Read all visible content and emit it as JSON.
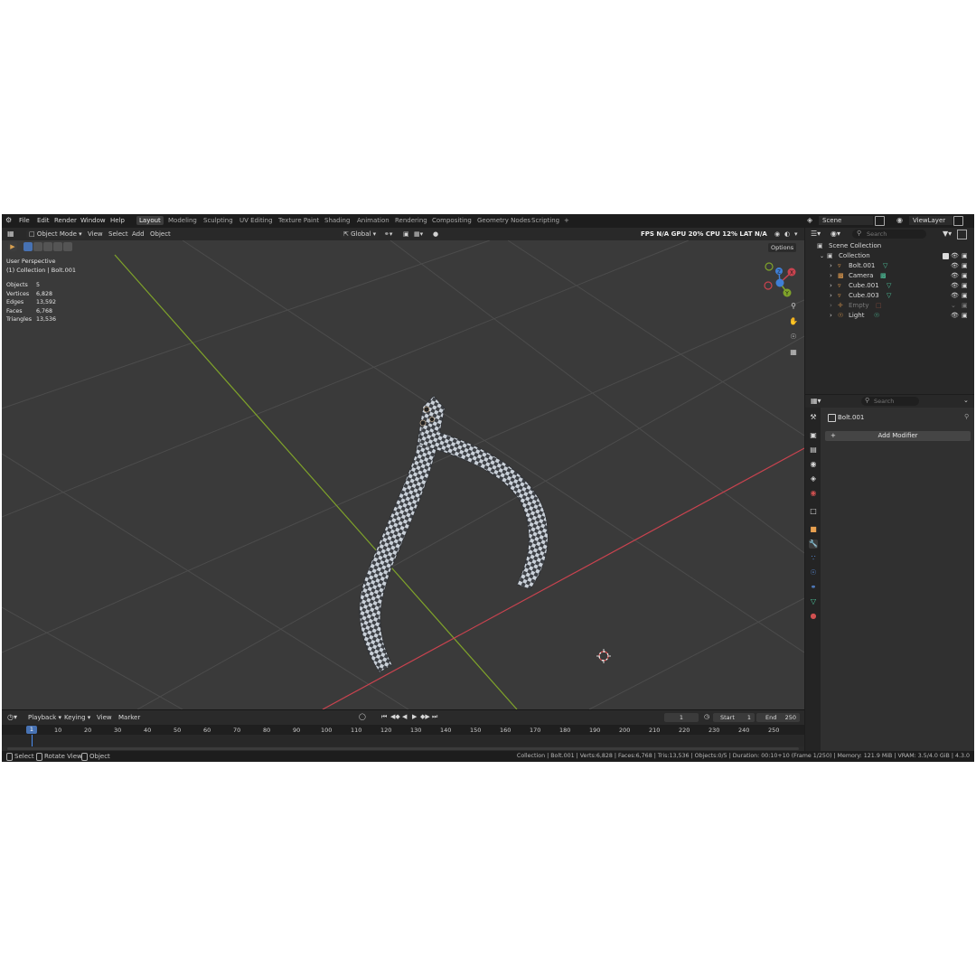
{
  "topbar": {
    "menus": [
      "File",
      "Edit",
      "Render",
      "Window",
      "Help"
    ],
    "workspaces": [
      "Layout",
      "Modeling",
      "Sculpting",
      "UV Editing",
      "Texture Paint",
      "Shading",
      "Animation",
      "Rendering",
      "Compositing",
      "Geometry Nodes",
      "Scripting"
    ],
    "add_tab": "+",
    "scene_label": "Scene",
    "viewlayer_label": "ViewLayer"
  },
  "viewport": {
    "mode": "Object Mode",
    "menus": [
      "View",
      "Select",
      "Add",
      "Object"
    ],
    "orientation": "Global",
    "perf_overlay": "FPS N/A GPU 20% CPU 12% LAT N/A",
    "options_label": "Options",
    "perspective": "User Perspective",
    "collection_line": "(1) Collection | Bolt.001",
    "stats": [
      {
        "label": "Objects",
        "value": "5"
      },
      {
        "label": "Vertices",
        "value": "6,828"
      },
      {
        "label": "Edges",
        "value": "13,592"
      },
      {
        "label": "Faces",
        "value": "6,768"
      },
      {
        "label": "Triangles",
        "value": "13,536"
      }
    ],
    "gizmo_axes": {
      "x": "X",
      "y": "Y",
      "z": "Z"
    },
    "colors": {
      "x_axis": "#c9434f",
      "y_axis": "#7fa32a",
      "z_axis": "#3f7fd6",
      "bg": "#3a3a3a",
      "grid": "#4a4a4a"
    }
  },
  "timeline": {
    "menus": [
      "Playback",
      "Keying",
      "View",
      "Marker"
    ],
    "current_frame": "1",
    "start_label": "Start",
    "start_value": "1",
    "end_label": "End",
    "end_value": "250",
    "ticks": [
      "1",
      "10",
      "20",
      "30",
      "40",
      "50",
      "60",
      "70",
      "80",
      "90",
      "100",
      "110",
      "120",
      "130",
      "140",
      "150",
      "160",
      "170",
      "180",
      "190",
      "200",
      "210",
      "220",
      "230",
      "240",
      "250"
    ]
  },
  "statusbar": {
    "hints": [
      "Select",
      "Rotate View",
      "Object"
    ],
    "info": "Collection | Bolt.001 | Verts:6,828 | Faces:6,768 | Tris:13,536 | Objects:0/5 | Duration: 00:10+10 (Frame 1/250) | Memory: 121.9 MiB | VRAM: 3.5/4.0 GiB | 4.3.0"
  },
  "outliner": {
    "search_placeholder": "Search",
    "scene_collection": "Scene Collection",
    "collection": "Collection",
    "items": [
      {
        "name": "Bolt.001",
        "icon": "mesh-icon",
        "dim": false
      },
      {
        "name": "Camera",
        "icon": "camera-icon",
        "dim": false
      },
      {
        "name": "Cube.001",
        "icon": "mesh-icon",
        "dim": false
      },
      {
        "name": "Cube.003",
        "icon": "mesh-icon",
        "dim": false
      },
      {
        "name": "Empty",
        "icon": "empty-icon",
        "dim": true
      },
      {
        "name": "Light",
        "icon": "light-icon",
        "dim": false
      }
    ]
  },
  "properties": {
    "search_placeholder": "Search",
    "object_name": "Bolt.001",
    "add_modifier": "Add Modifier"
  }
}
